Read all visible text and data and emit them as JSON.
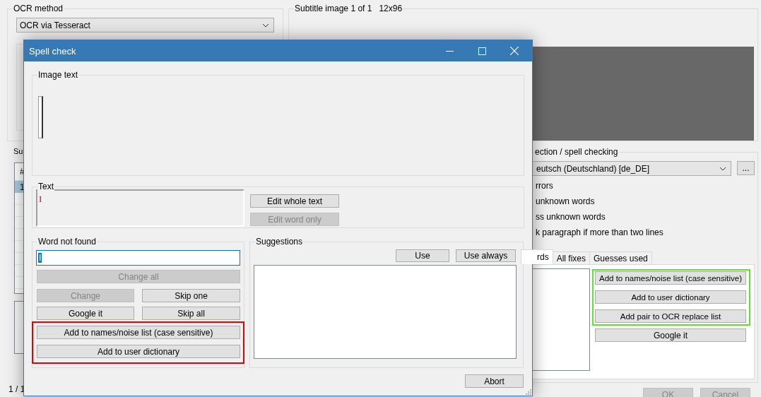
{
  "main_window": {
    "ocr_method": {
      "label": "OCR method",
      "value": "OCR via Tesseract"
    },
    "subtitle_image": {
      "label": "Subtitle image 1 of 1   12x96"
    },
    "subtitles": {
      "label": "Su",
      "columns": [
        "#"
      ],
      "rows": [
        {
          "cells": [
            "1"
          ],
          "selected": true
        }
      ]
    },
    "position": "1 / 1",
    "spell_checking": {
      "label": "ection / spell checking",
      "dictionary": "eutsch (Deutschland) [de_DE]",
      "more_button": "...",
      "options": [
        "rrors",
        "unknown words",
        "ss unknown words",
        "k paragraph if more than two lines"
      ],
      "tabs": [
        {
          "label": "rds",
          "selected": true
        },
        {
          "label": "All fixes",
          "selected": false
        },
        {
          "label": "Guesses used",
          "selected": false
        }
      ],
      "highlighted_buttons": [
        "Add to names/noise list (case sensitive)",
        "Add to user dictionary",
        "Add pair to OCR replace list"
      ],
      "google_button": "Google it"
    },
    "footer_buttons": [
      {
        "label": "OK",
        "disabled": true
      },
      {
        "label": "Cancel",
        "disabled": true
      }
    ]
  },
  "dialog": {
    "title": "Spell check",
    "image_text": {
      "label": "Image text"
    },
    "text": {
      "label": "Text",
      "value": "I",
      "edit_buttons": [
        {
          "label": "Edit whole text",
          "disabled": false
        },
        {
          "label": "Edit word only",
          "disabled": true
        }
      ]
    },
    "word_not_found": {
      "label": "Word not found",
      "value": "I",
      "change_all": {
        "label": "Change all",
        "disabled": true
      },
      "buttons": [
        {
          "label": "Change",
          "disabled": true
        },
        {
          "label": "Skip one",
          "disabled": false
        },
        {
          "label": "Google it",
          "disabled": false
        },
        {
          "label": "Skip all",
          "disabled": false
        }
      ],
      "highlighted_buttons": [
        "Add to names/noise list (case sensitive)",
        "Add to user dictionary"
      ]
    },
    "suggestions": {
      "label": "Suggestions",
      "buttons": [
        "Use",
        "Use always"
      ]
    },
    "abort_button": "Abort"
  }
}
